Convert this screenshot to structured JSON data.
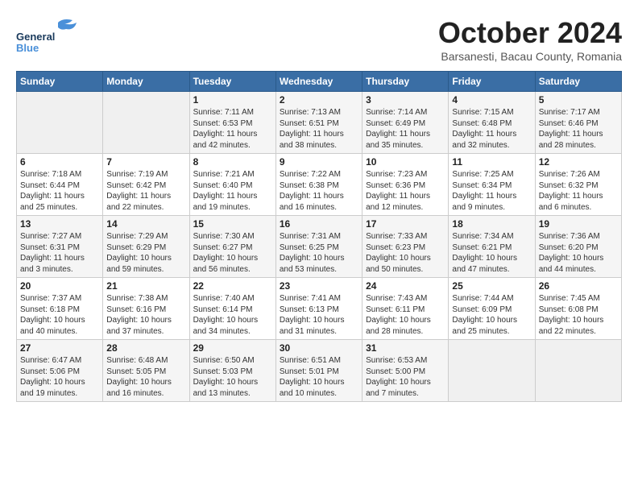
{
  "header": {
    "logo_general": "General",
    "logo_blue": "Blue",
    "month_title": "October 2024",
    "subtitle": "Barsanesti, Bacau County, Romania"
  },
  "weekdays": [
    "Sunday",
    "Monday",
    "Tuesday",
    "Wednesday",
    "Thursday",
    "Friday",
    "Saturday"
  ],
  "weeks": [
    [
      {
        "day": "",
        "info": ""
      },
      {
        "day": "",
        "info": ""
      },
      {
        "day": "1",
        "info": "Sunrise: 7:11 AM\nSunset: 6:53 PM\nDaylight: 11 hours and 42 minutes."
      },
      {
        "day": "2",
        "info": "Sunrise: 7:13 AM\nSunset: 6:51 PM\nDaylight: 11 hours and 38 minutes."
      },
      {
        "day": "3",
        "info": "Sunrise: 7:14 AM\nSunset: 6:49 PM\nDaylight: 11 hours and 35 minutes."
      },
      {
        "day": "4",
        "info": "Sunrise: 7:15 AM\nSunset: 6:48 PM\nDaylight: 11 hours and 32 minutes."
      },
      {
        "day": "5",
        "info": "Sunrise: 7:17 AM\nSunset: 6:46 PM\nDaylight: 11 hours and 28 minutes."
      }
    ],
    [
      {
        "day": "6",
        "info": "Sunrise: 7:18 AM\nSunset: 6:44 PM\nDaylight: 11 hours and 25 minutes."
      },
      {
        "day": "7",
        "info": "Sunrise: 7:19 AM\nSunset: 6:42 PM\nDaylight: 11 hours and 22 minutes."
      },
      {
        "day": "8",
        "info": "Sunrise: 7:21 AM\nSunset: 6:40 PM\nDaylight: 11 hours and 19 minutes."
      },
      {
        "day": "9",
        "info": "Sunrise: 7:22 AM\nSunset: 6:38 PM\nDaylight: 11 hours and 16 minutes."
      },
      {
        "day": "10",
        "info": "Sunrise: 7:23 AM\nSunset: 6:36 PM\nDaylight: 11 hours and 12 minutes."
      },
      {
        "day": "11",
        "info": "Sunrise: 7:25 AM\nSunset: 6:34 PM\nDaylight: 11 hours and 9 minutes."
      },
      {
        "day": "12",
        "info": "Sunrise: 7:26 AM\nSunset: 6:32 PM\nDaylight: 11 hours and 6 minutes."
      }
    ],
    [
      {
        "day": "13",
        "info": "Sunrise: 7:27 AM\nSunset: 6:31 PM\nDaylight: 11 hours and 3 minutes."
      },
      {
        "day": "14",
        "info": "Sunrise: 7:29 AM\nSunset: 6:29 PM\nDaylight: 10 hours and 59 minutes."
      },
      {
        "day": "15",
        "info": "Sunrise: 7:30 AM\nSunset: 6:27 PM\nDaylight: 10 hours and 56 minutes."
      },
      {
        "day": "16",
        "info": "Sunrise: 7:31 AM\nSunset: 6:25 PM\nDaylight: 10 hours and 53 minutes."
      },
      {
        "day": "17",
        "info": "Sunrise: 7:33 AM\nSunset: 6:23 PM\nDaylight: 10 hours and 50 minutes."
      },
      {
        "day": "18",
        "info": "Sunrise: 7:34 AM\nSunset: 6:21 PM\nDaylight: 10 hours and 47 minutes."
      },
      {
        "day": "19",
        "info": "Sunrise: 7:36 AM\nSunset: 6:20 PM\nDaylight: 10 hours and 44 minutes."
      }
    ],
    [
      {
        "day": "20",
        "info": "Sunrise: 7:37 AM\nSunset: 6:18 PM\nDaylight: 10 hours and 40 minutes."
      },
      {
        "day": "21",
        "info": "Sunrise: 7:38 AM\nSunset: 6:16 PM\nDaylight: 10 hours and 37 minutes."
      },
      {
        "day": "22",
        "info": "Sunrise: 7:40 AM\nSunset: 6:14 PM\nDaylight: 10 hours and 34 minutes."
      },
      {
        "day": "23",
        "info": "Sunrise: 7:41 AM\nSunset: 6:13 PM\nDaylight: 10 hours and 31 minutes."
      },
      {
        "day": "24",
        "info": "Sunrise: 7:43 AM\nSunset: 6:11 PM\nDaylight: 10 hours and 28 minutes."
      },
      {
        "day": "25",
        "info": "Sunrise: 7:44 AM\nSunset: 6:09 PM\nDaylight: 10 hours and 25 minutes."
      },
      {
        "day": "26",
        "info": "Sunrise: 7:45 AM\nSunset: 6:08 PM\nDaylight: 10 hours and 22 minutes."
      }
    ],
    [
      {
        "day": "27",
        "info": "Sunrise: 6:47 AM\nSunset: 5:06 PM\nDaylight: 10 hours and 19 minutes."
      },
      {
        "day": "28",
        "info": "Sunrise: 6:48 AM\nSunset: 5:05 PM\nDaylight: 10 hours and 16 minutes."
      },
      {
        "day": "29",
        "info": "Sunrise: 6:50 AM\nSunset: 5:03 PM\nDaylight: 10 hours and 13 minutes."
      },
      {
        "day": "30",
        "info": "Sunrise: 6:51 AM\nSunset: 5:01 PM\nDaylight: 10 hours and 10 minutes."
      },
      {
        "day": "31",
        "info": "Sunrise: 6:53 AM\nSunset: 5:00 PM\nDaylight: 10 hours and 7 minutes."
      },
      {
        "day": "",
        "info": ""
      },
      {
        "day": "",
        "info": ""
      }
    ]
  ]
}
